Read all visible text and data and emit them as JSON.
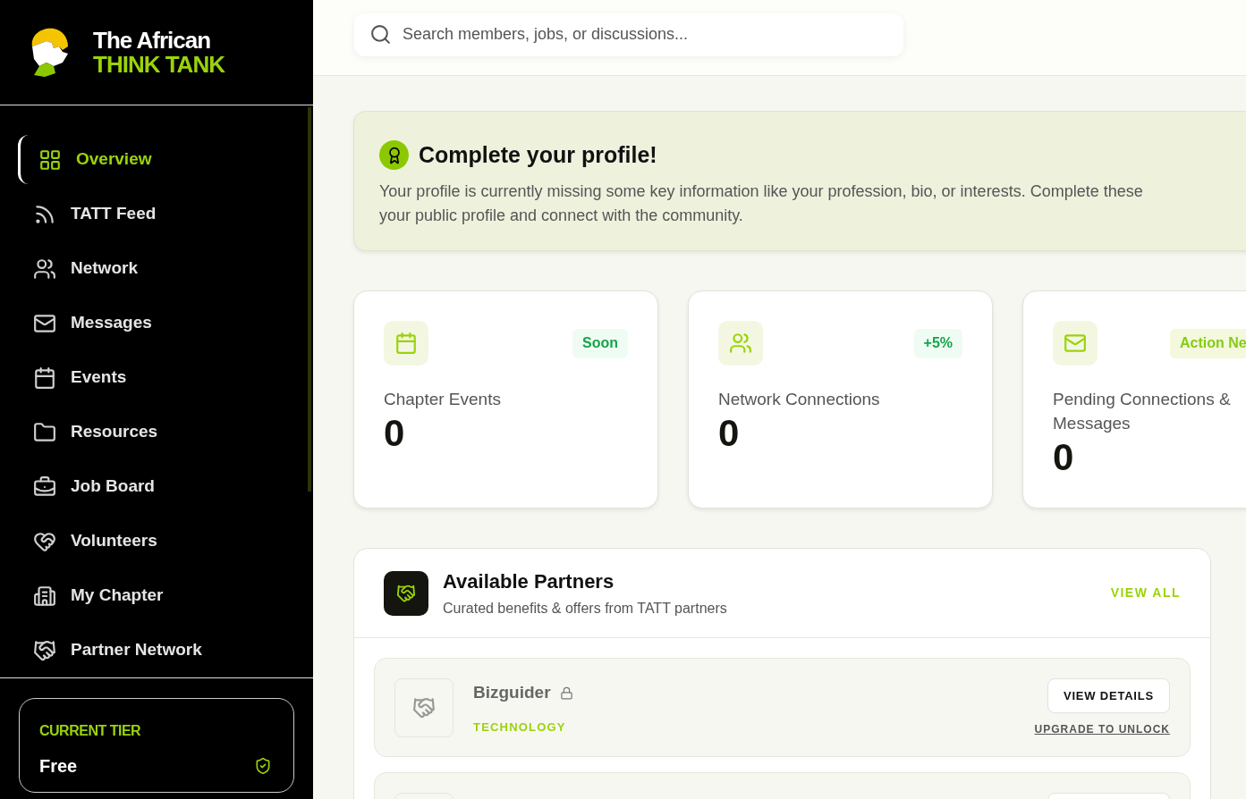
{
  "brand": {
    "line1": "The African",
    "line2": "THINK TANK"
  },
  "nav": [
    {
      "label": "Overview",
      "selected": true
    },
    {
      "label": "TATT Feed",
      "selected": false
    },
    {
      "label": "Network",
      "selected": false
    },
    {
      "label": "Messages",
      "selected": false
    },
    {
      "label": "Events",
      "selected": false
    },
    {
      "label": "Resources",
      "selected": false
    },
    {
      "label": "Job Board",
      "selected": false
    },
    {
      "label": "Volunteers",
      "selected": false
    },
    {
      "label": "My Chapter",
      "selected": false
    },
    {
      "label": "Partner Network",
      "selected": false
    }
  ],
  "tier": {
    "label": "CURRENT TIER",
    "value": "Free"
  },
  "search": {
    "placeholder": "Search members, jobs, or discussions..."
  },
  "profile_alert": {
    "title": "Complete your profile!",
    "description_lines": [
      "Your profile is currently missing some key information like your profession, bio, or interests. Complete these",
      "your public profile and connect with the community."
    ]
  },
  "stats": [
    {
      "badge": "Soon",
      "color": "#16a34a",
      "label": "Chapter Events",
      "value": "0"
    },
    {
      "badge": "+5%",
      "color": "#16a34a",
      "label": "Network Connections",
      "value": "0"
    },
    {
      "badge": "Action Ne",
      "color": "#84cc16",
      "label": "Pending Connections & Messages",
      "value": "0"
    }
  ],
  "partners_panel": {
    "title": "Available Partners",
    "subtitle": "Curated benefits & offers from TATT partners",
    "view_all": "VIEW ALL",
    "partners": [
      {
        "name": "Bizguider",
        "locked": true,
        "category": "TECHNOLOGY",
        "button": "VIEW DETAILS",
        "link": "UPGRADE TO UNLOCK"
      }
    ]
  }
}
